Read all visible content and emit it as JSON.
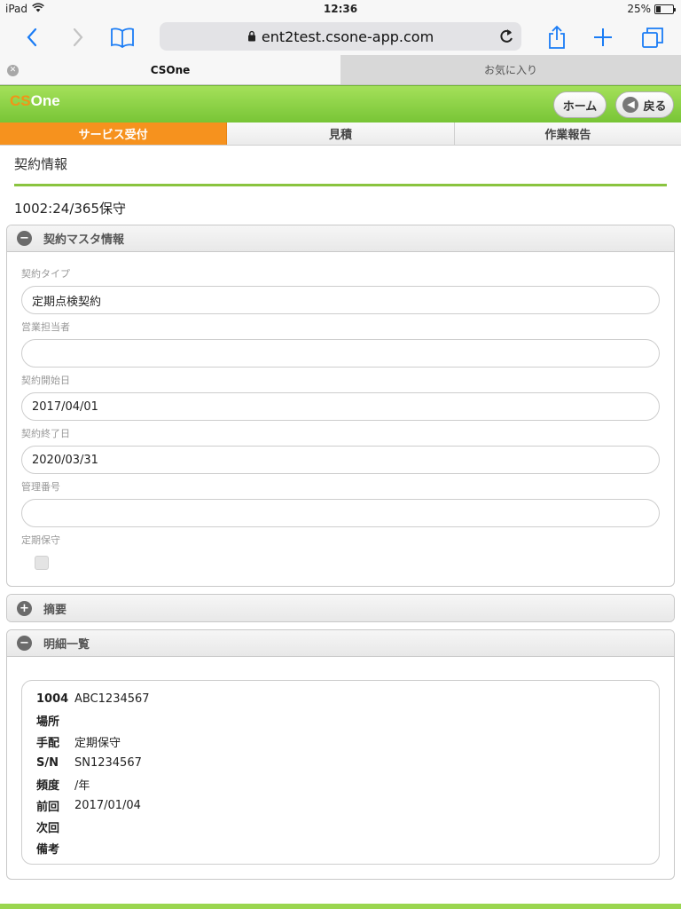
{
  "status_bar": {
    "device": "iPad",
    "time": "12:36",
    "battery": "25%",
    "battery_level": 0.25
  },
  "browser": {
    "url": "ent2test.csone-app.com",
    "tabs": [
      {
        "label": "CSOne",
        "active": true
      },
      {
        "label": "お気に入り",
        "active": false
      }
    ]
  },
  "app": {
    "logo_cs": "CS",
    "logo_one": "One",
    "home_button": "ホーム",
    "back_button": "戻る"
  },
  "nav_tabs": [
    {
      "label": "サービス受付",
      "active": true
    },
    {
      "label": "見積",
      "active": false
    },
    {
      "label": "作業報告",
      "active": false
    }
  ],
  "page": {
    "title": "契約情報",
    "contract_id": "1002:24/365保守"
  },
  "master_section": {
    "title": "契約マスタ情報",
    "fields": [
      {
        "label": "契約タイプ",
        "value": "定期点検契約"
      },
      {
        "label": "営業担当者",
        "value": ""
      },
      {
        "label": "契約開始日",
        "value": "2017/04/01"
      },
      {
        "label": "契約終了日",
        "value": "2020/03/31"
      },
      {
        "label": "管理番号",
        "value": ""
      }
    ],
    "checkbox_label": "定期保守",
    "checkbox_checked": false
  },
  "summary_section": {
    "title": "摘要"
  },
  "detail_section": {
    "title": "明細一覧",
    "rows": [
      {
        "key": "1004",
        "value": "ABC1234567"
      },
      {
        "key": "場所",
        "value": ""
      },
      {
        "key": "手配",
        "value": "定期保守"
      },
      {
        "key": "S/N",
        "value": "SN1234567"
      },
      {
        "key": "頻度",
        "value": "/年"
      },
      {
        "key": "前回",
        "value": "2017/01/04"
      },
      {
        "key": "次回",
        "value": ""
      },
      {
        "key": "備考",
        "value": ""
      }
    ]
  },
  "colors": {
    "accent_green": "#8ac43f",
    "accent_orange": "#f6921e",
    "ios_blue": "#1a7cf5"
  }
}
